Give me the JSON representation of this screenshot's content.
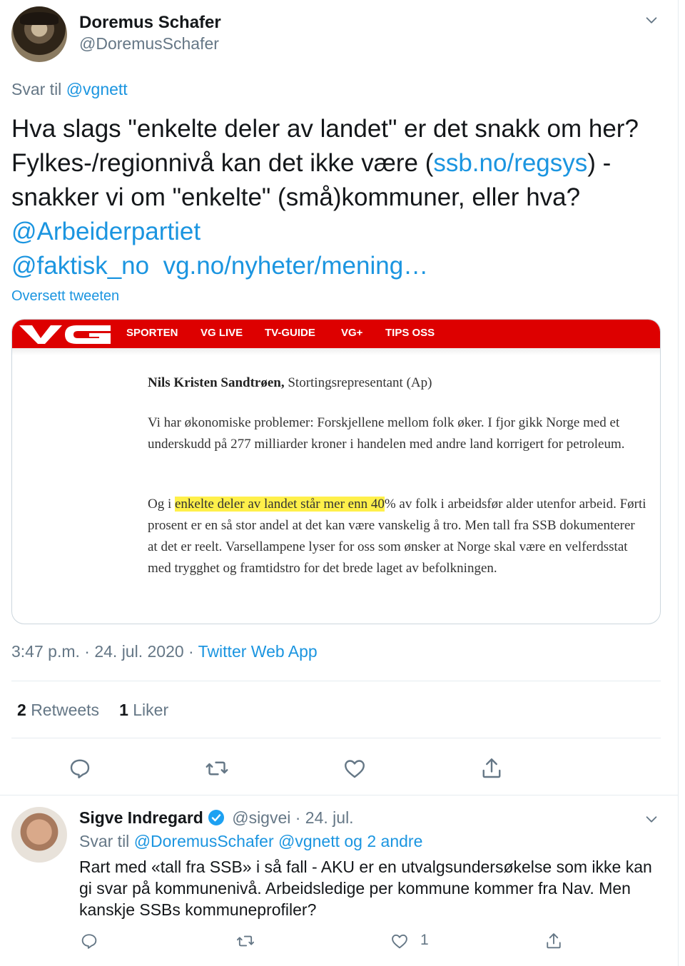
{
  "main_tweet": {
    "name": "Doremus Schafer",
    "handle": "@DoremusSchafer",
    "reply_prefix": "Svar til",
    "reply_handle": "@vgnett",
    "text_parts": [
      "Hva slags \"enkelte deler av landet\" er det snakk om her? Fylkes-/regionnivå kan det ikke være (",
      "ssb.no/regsys",
      ") - snakker vi om \"enkelte\" (små)kommuner, eller hva? ",
      "@Arbeiderpartiet",
      "@faktisk_no",
      "vg.no/nyheter/mening…"
    ],
    "translate_label": "Oversett tweeten",
    "timestamp": "3:47 p.m. · 24. jul. 2020 · ",
    "source": "Twitter Web App",
    "retweets_count": "2",
    "retweets_label": "Retweets",
    "likes_count": "1",
    "likes_label": "Liker"
  },
  "embed": {
    "nav": [
      "SPORTEN",
      "VG LIVE",
      "TV-GUIDE",
      "VG+",
      "TIPS OSS"
    ],
    "author_name": "Nils Kristen Sandtrøen,",
    "author_role": " Stortingsrepresentant (Ap)",
    "para1": "Vi har økonomiske problemer: Forskjellene mellom folk øker. I fjor gikk Norge med et underskudd på 277 milliarder kroner i handelen med andre land korrigert for petroleum.",
    "para2_pre": "Og i ",
    "para2_highlight": "enkelte deler av landet står mer enn 40",
    "para2_post": "% av folk i arbeidsfør alder utenfor arbeid. Førti prosent er en så stor andel at det kan være vanskelig å tro. Men tall fra SSB dokumenterer at det er reelt. Varsellampene lyser for oss som ønsker at Norge skal være en velferdsstat med trygghet og framtidstro for det brede laget av befolkningen."
  },
  "reply_tweet": {
    "name": "Sigve Indregard",
    "handle_date": " @sigvei · 24. jul.",
    "reply_prefix": "Svar til",
    "reply_handles": "@DoremusSchafer @vgnett og 2 andre",
    "text": "Rart med «tall fra SSB» i så fall - AKU er en utvalgsundersøkelse som ikke kan gi svar på kommunenivå. Arbeidsledige per kommune kommer fra Nav. Men kanskje SSBs kommuneprofiler?",
    "like_count": "1"
  },
  "colors": {
    "link": "#1b95e0",
    "muted": "#657786",
    "vg_red": "#dd0000",
    "highlight": "#fff04a"
  }
}
